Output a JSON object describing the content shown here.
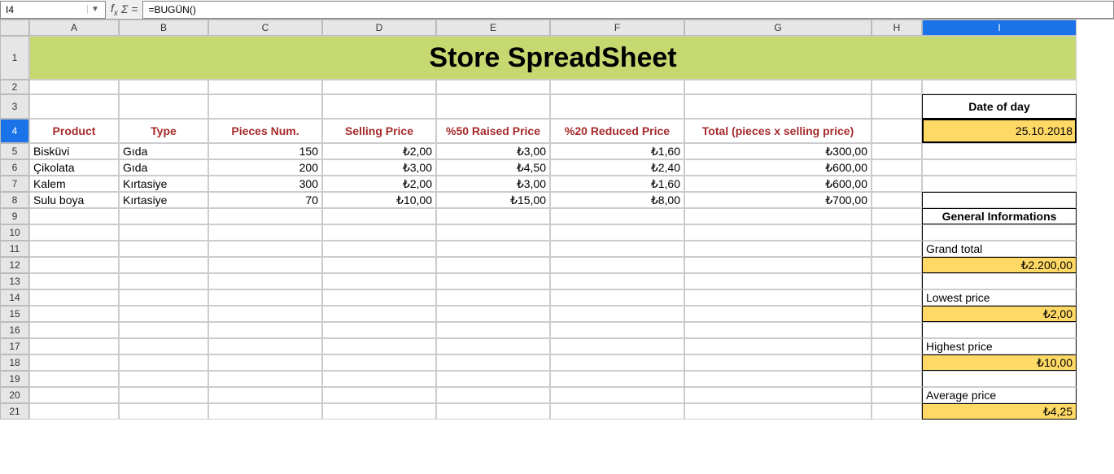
{
  "formula_bar": {
    "cell_ref": "I4",
    "formula": "=BUGÜN()"
  },
  "columns": [
    "A",
    "B",
    "C",
    "D",
    "E",
    "F",
    "G",
    "H",
    "I"
  ],
  "row_numbers": [
    "1",
    "2",
    "3",
    "4",
    "5",
    "6",
    "7",
    "8",
    "9",
    "10",
    "11",
    "12",
    "13",
    "14",
    "15",
    "16",
    "17",
    "18",
    "19",
    "20",
    "21"
  ],
  "title": "Store SpreadSheet",
  "headers": {
    "product": "Product",
    "type": "Type",
    "pieces": "Pieces Num.",
    "selling": "Selling Price",
    "raised": "%50 Raised Price",
    "reduced": "%20 Reduced Price",
    "total": "Total (pieces x selling price)"
  },
  "rows": [
    {
      "product": "Bisküvi",
      "type": "Gıda",
      "pieces": "150",
      "selling": "₺2,00",
      "raised": "₺3,00",
      "reduced": "₺1,60",
      "total": "₺300,00"
    },
    {
      "product": "Çikolata",
      "type": "Gıda",
      "pieces": "200",
      "selling": "₺3,00",
      "raised": "₺4,50",
      "reduced": "₺2,40",
      "total": "₺600,00"
    },
    {
      "product": "Kalem",
      "type": "Kırtasiye",
      "pieces": "300",
      "selling": "₺2,00",
      "raised": "₺3,00",
      "reduced": "₺1,60",
      "total": "₺600,00"
    },
    {
      "product": "Sulu boya",
      "type": "Kırtasiye",
      "pieces": "70",
      "selling": "₺10,00",
      "raised": "₺15,00",
      "reduced": "₺8,00",
      "total": "₺700,00"
    }
  ],
  "side": {
    "date_label": "Date of day",
    "date_value": "25.10.2018",
    "gen_info": "General Informations",
    "grand_label": "Grand total",
    "grand_value": "₺2.200,00",
    "lowest_label": "Lowest price",
    "lowest_value": "₺2,00",
    "highest_label": "Highest price",
    "highest_value": "₺10,00",
    "avg_label": "Average price",
    "avg_value": "₺4,25"
  }
}
